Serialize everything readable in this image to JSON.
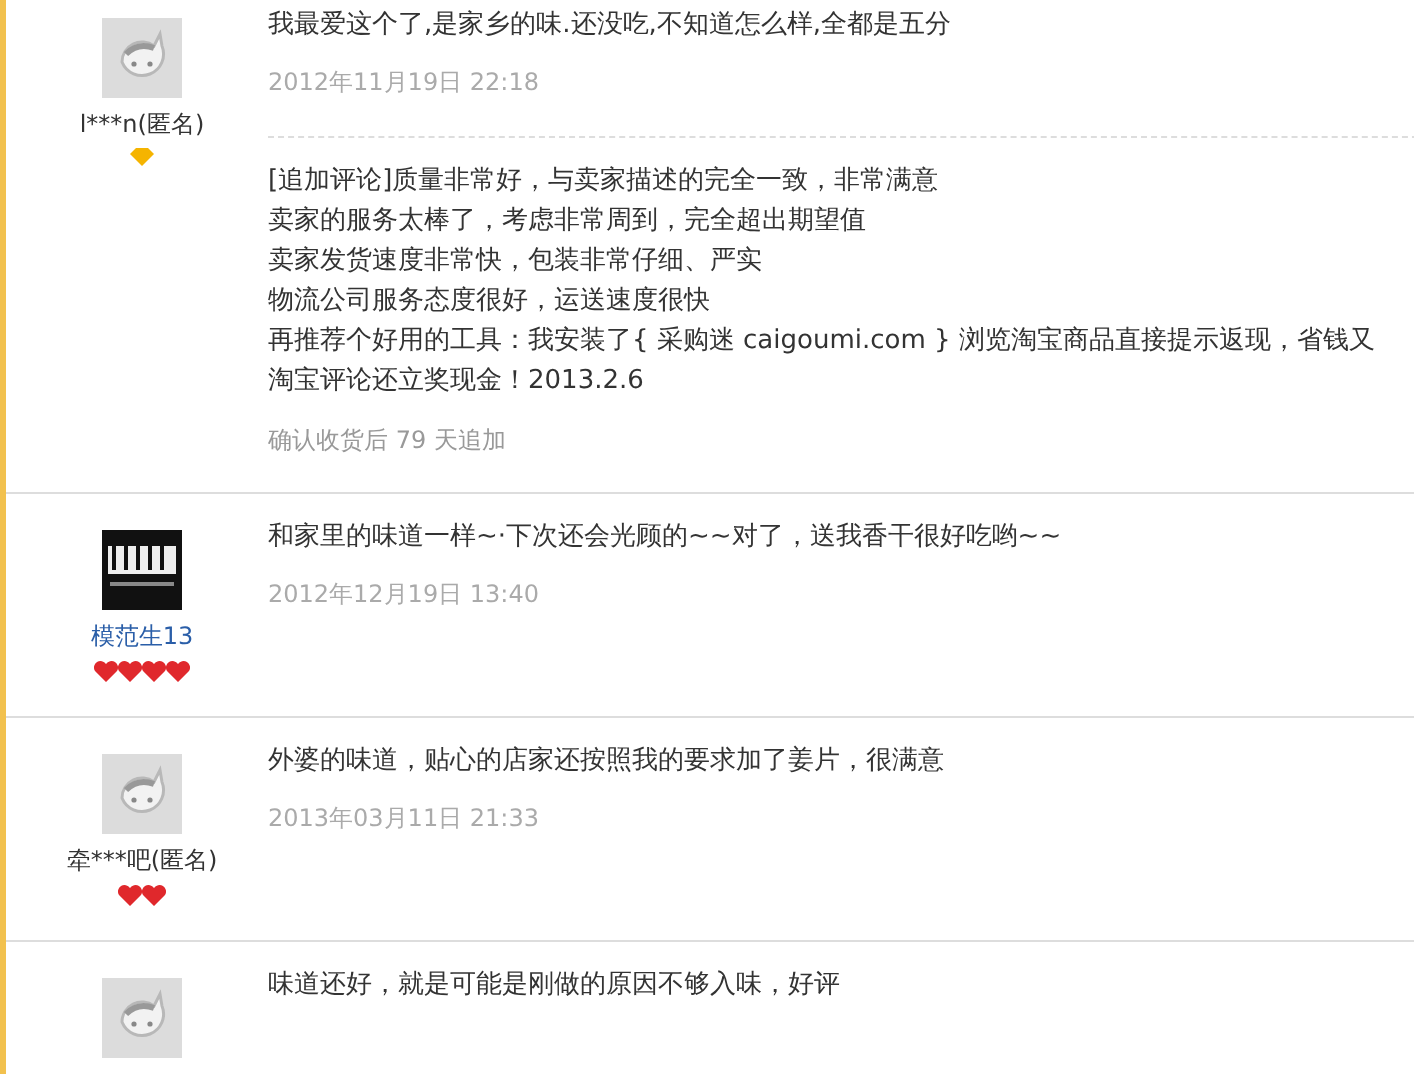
{
  "reviews": [
    {
      "kind": "default-avatar",
      "user": {
        "name": "l***n(匿名)",
        "anonymous": true
      },
      "rank": [
        {
          "kind": "diamond"
        }
      ],
      "comment": "我最爱这个了,是家乡的味.还没吃,不知道怎么样,全都是五分",
      "date": "2012年11月19日 22:18",
      "followup": {
        "lines": [
          "[追加评论]质量非常好，与卖家描述的完全一致，非常满意",
          "卖家的服务太棒了，考虑非常周到，完全超出期望值",
          "卖家发货速度非常快，包装非常仔细、严实",
          "物流公司服务态度很好，运送速度很快",
          "再推荐个好用的工具：我安装了{ 采购迷 caigoumi.com } 浏览淘宝商品直接提示返现，省钱又",
          "淘宝评论还立奖现金！2013.2.6"
        ],
        "note": "确认收货后 79 天追加"
      }
    },
    {
      "kind": "photo-avatar",
      "user": {
        "name": "模范生13",
        "anonymous": false
      },
      "rank": [
        {
          "kind": "heart"
        },
        {
          "kind": "heart"
        },
        {
          "kind": "heart"
        },
        {
          "kind": "heart"
        }
      ],
      "comment": "和家里的味道一样~·下次还会光顾的~~对了，送我香干很好吃哟~~",
      "date": "2012年12月19日 13:40"
    },
    {
      "kind": "default-avatar",
      "user": {
        "name": "牵***吧(匿名)",
        "anonymous": true
      },
      "rank": [
        {
          "kind": "heart"
        },
        {
          "kind": "heart"
        }
      ],
      "comment": "外婆的味道，贴心的店家还按照我的要求加了姜片，很满意",
      "date": "2013年03月11日 21:33"
    },
    {
      "kind": "default-avatar",
      "comment": "味道还好，就是可能是刚做的原因不够入味，好评"
    }
  ]
}
